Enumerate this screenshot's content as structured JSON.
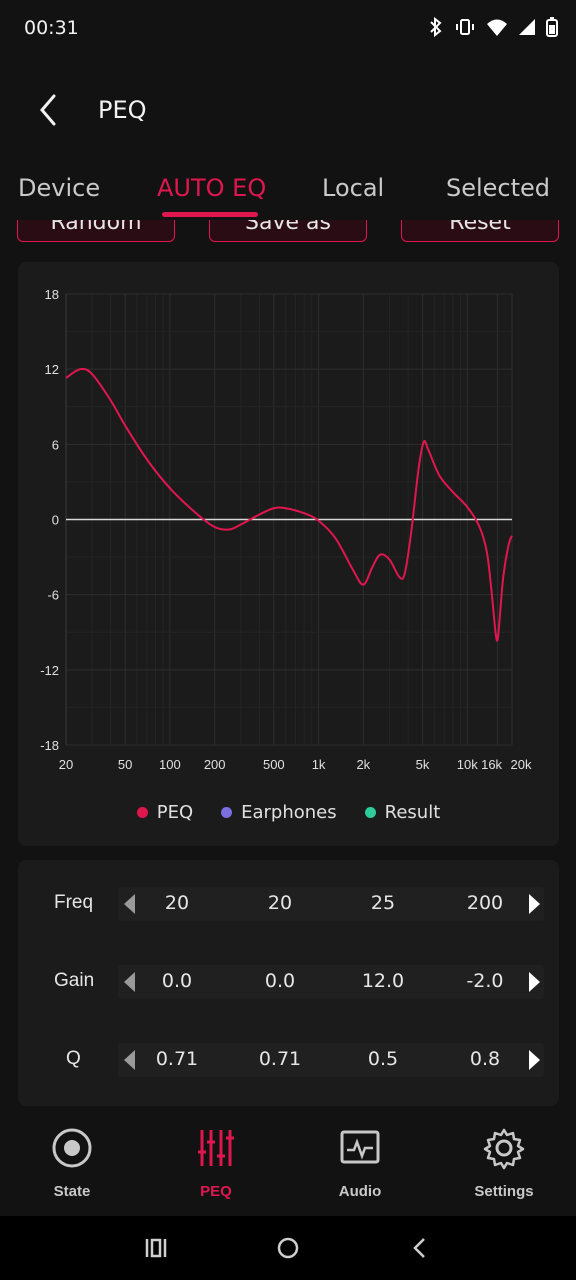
{
  "status_bar": {
    "time": "00:31"
  },
  "app_bar": {
    "title": "PEQ"
  },
  "tabs": [
    {
      "label": "Device",
      "active": false
    },
    {
      "label": "AUTO EQ",
      "active": true
    },
    {
      "label": "Local",
      "active": false
    },
    {
      "label": "Selected",
      "active": false
    }
  ],
  "actions": {
    "random": "Random",
    "save_as": "Save as",
    "reset": "Reset"
  },
  "chart_data": {
    "type": "line",
    "x_scale": "log",
    "xlim": [
      20,
      20000
    ],
    "ylim": [
      -18,
      18
    ],
    "x_ticks": [
      "20",
      "50",
      "100",
      "200",
      "500",
      "1k",
      "2k",
      "5k",
      "10k",
      "16k",
      "20k"
    ],
    "y_ticks": [
      "18",
      "12",
      "6",
      "0",
      "-6",
      "-12",
      "-18"
    ],
    "grid": true,
    "legend_position": "bottom",
    "series": [
      {
        "name": "PEQ",
        "color": "#e0174f",
        "points": [
          [
            20,
            11.3
          ],
          [
            25,
            12.0
          ],
          [
            30,
            11.6
          ],
          [
            40,
            9.5
          ],
          [
            50,
            7.5
          ],
          [
            70,
            4.8
          ],
          [
            100,
            2.5
          ],
          [
            150,
            0.5
          ],
          [
            200,
            -0.6
          ],
          [
            250,
            -0.8
          ],
          [
            300,
            -0.4
          ],
          [
            400,
            0.4
          ],
          [
            500,
            0.9
          ],
          [
            600,
            0.9
          ],
          [
            800,
            0.5
          ],
          [
            1000,
            -0.1
          ],
          [
            1300,
            -1.5
          ],
          [
            1700,
            -4.0
          ],
          [
            2000,
            -5.2
          ],
          [
            2300,
            -3.8
          ],
          [
            2600,
            -2.8
          ],
          [
            3000,
            -3.2
          ],
          [
            3500,
            -4.6
          ],
          [
            3800,
            -4.3
          ],
          [
            4200,
            -1.0
          ],
          [
            4700,
            4.0
          ],
          [
            5100,
            6.2
          ],
          [
            5500,
            5.5
          ],
          [
            6500,
            3.5
          ],
          [
            8000,
            2.2
          ],
          [
            10000,
            1.0
          ],
          [
            12000,
            -0.5
          ],
          [
            13500,
            -2.5
          ],
          [
            14500,
            -5.5
          ],
          [
            15500,
            -9.0
          ],
          [
            16000,
            -9.6
          ],
          [
            16500,
            -8.0
          ],
          [
            17500,
            -4.5
          ],
          [
            19000,
            -2.0
          ],
          [
            20000,
            -1.3
          ]
        ]
      },
      {
        "name": "Earphones",
        "color": "#7b6fe0",
        "points": []
      },
      {
        "name": "Result",
        "color": "#2ecc9b",
        "points": []
      }
    ]
  },
  "legend": [
    {
      "name": "PEQ",
      "color": "#e0174f"
    },
    {
      "name": "Earphones",
      "color": "#7b6fe0"
    },
    {
      "name": "Result",
      "color": "#2ecc9b"
    }
  ],
  "params": {
    "freq": {
      "label": "Freq",
      "values": [
        "20",
        "20",
        "25",
        "200"
      ]
    },
    "gain": {
      "label": "Gain",
      "values": [
        "0.0",
        "0.0",
        "12.0",
        "-2.0"
      ]
    },
    "q": {
      "label": "Q",
      "values": [
        "0.71",
        "0.71",
        "0.5",
        "0.8"
      ]
    }
  },
  "bottom_nav": [
    {
      "label": "State",
      "icon": "state-icon",
      "active": false
    },
    {
      "label": "PEQ",
      "icon": "sliders-icon",
      "active": true
    },
    {
      "label": "Audio",
      "icon": "waveform-icon",
      "active": false
    },
    {
      "label": "Settings",
      "icon": "gear-icon",
      "active": false
    }
  ]
}
